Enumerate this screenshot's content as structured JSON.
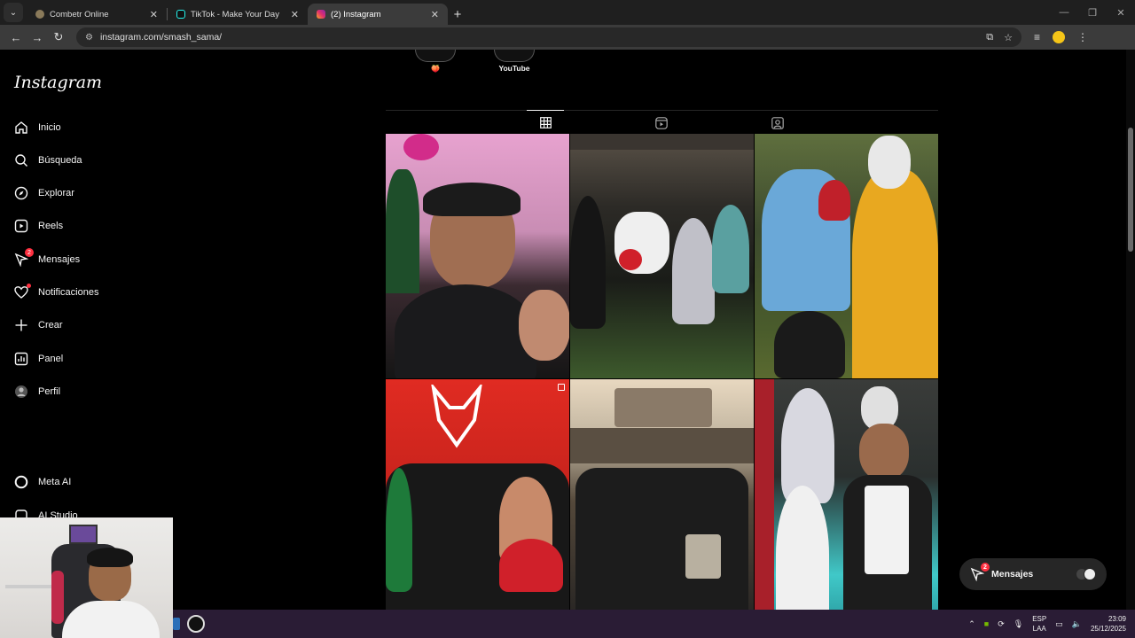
{
  "browser": {
    "tabs": [
      {
        "title": "Combetr Online",
        "favicon_color": "#8a7a5a",
        "active": false
      },
      {
        "title": "TikTok - Make Your Day",
        "favicon_color": "#111111",
        "active": false
      },
      {
        "title": "(2) Instagram",
        "favicon_color": "#e1306c",
        "active": true
      }
    ],
    "url": "instagram.com/smash_sama/"
  },
  "sidebar": {
    "logo": "Instagram",
    "items": [
      {
        "label": "Inicio",
        "icon": "home-icon"
      },
      {
        "label": "Búsqueda",
        "icon": "search-icon"
      },
      {
        "label": "Explorar",
        "icon": "compass-icon"
      },
      {
        "label": "Reels",
        "icon": "reels-icon"
      },
      {
        "label": "Mensajes",
        "icon": "messenger-icon",
        "badge": "2"
      },
      {
        "label": "Notificaciones",
        "icon": "heart-icon",
        "dot": true
      },
      {
        "label": "Crear",
        "icon": "plus-icon"
      },
      {
        "label": "Panel",
        "icon": "chart-icon"
      },
      {
        "label": "Perfil",
        "icon": "profile-icon"
      }
    ],
    "bottom_items": [
      {
        "label": "Meta AI",
        "icon": "meta-ai-icon"
      },
      {
        "label": "AI Studio",
        "icon": "ai-studio-icon"
      }
    ]
  },
  "profile": {
    "highlights": [
      {
        "label": "🍑"
      },
      {
        "label": "YouTube"
      }
    ],
    "tabs": [
      {
        "name": "posts",
        "icon": "grid-icon",
        "active": true
      },
      {
        "name": "reels",
        "icon": "reels-icon",
        "active": false
      },
      {
        "name": "tagged",
        "icon": "tagged-icon",
        "active": false
      }
    ],
    "posts": [
      {
        "desc": "selfie",
        "multi": false
      },
      {
        "desc": "group-costume",
        "multi": true
      },
      {
        "desc": "costume-duo",
        "multi": false
      },
      {
        "desc": "gym-group",
        "multi": true
      },
      {
        "desc": "group-rooftop",
        "multi": false
      },
      {
        "desc": "cosplay-duo",
        "multi": false
      }
    ]
  },
  "messages_pill": {
    "label": "Mensajes",
    "badge": "2"
  },
  "taskbar": {
    "lang_top": "ESP",
    "lang_bottom": "LAA",
    "time": "23:09",
    "date": "25/12/2025"
  },
  "colors": {
    "accent_badge": "#ff3040",
    "background": "#000000"
  }
}
